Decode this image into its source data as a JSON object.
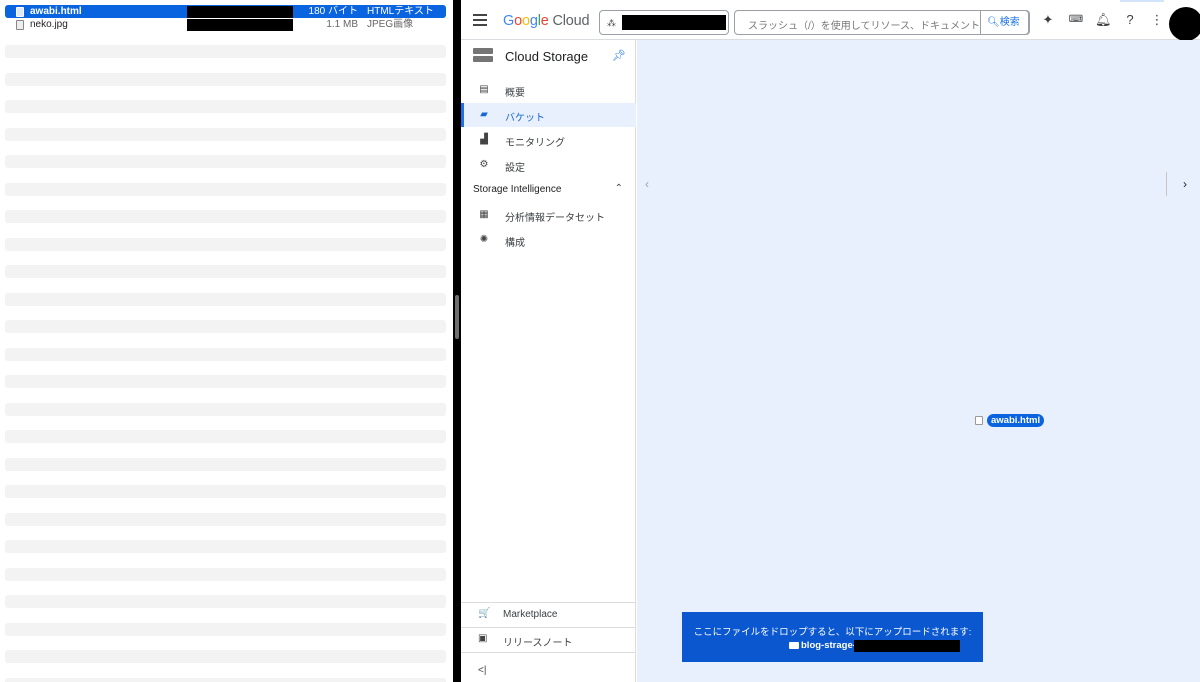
{
  "finder": {
    "files": [
      {
        "name": "awabi.html",
        "size": "180 バイト",
        "kind": "HTMLテキスト",
        "selected": true
      },
      {
        "name": "neko.jpg",
        "size": "1.1 MB",
        "kind": "JPEG画像",
        "selected": false
      }
    ]
  },
  "gcloud": {
    "logo": {
      "g": "G",
      "o1": "o",
      "o2": "o",
      "g2": "g",
      "l": "l",
      "e": "e",
      "cloud": " Cloud"
    },
    "search": {
      "placeholder": "スラッシュ（/）を使用してリソース、ドキュメント、プロダクトなどを検索",
      "button": "検索"
    },
    "icons": {
      "gemini": "sparkle-icon",
      "shell": "terminal-icon",
      "bell": "bell-icon",
      "help": "help-icon",
      "more": "more-vert-icon"
    },
    "sidebar": {
      "title": "Cloud Storage",
      "items": [
        {
          "label": "概要",
          "icon": "▤"
        },
        {
          "label": "バケット",
          "icon": "▰"
        },
        {
          "label": "モニタリング",
          "icon": "▟"
        },
        {
          "label": "設定",
          "icon": "⚙"
        }
      ],
      "section": "Storage Intelligence",
      "section_items": [
        {
          "label": "分析情報データセット",
          "icon": "▦"
        },
        {
          "label": "構成",
          "icon": "✺"
        }
      ],
      "bottom": [
        {
          "label": "Marketplace",
          "icon": "🛒"
        },
        {
          "label": "リリースノート",
          "icon": "▣"
        }
      ],
      "collapse": "<|"
    },
    "drop": {
      "dragging_file": "awabi.html",
      "message": "ここにファイルをドロップすると、以下にアップロードされます:",
      "bucket_prefix": "blog-strage-"
    },
    "colors": {
      "accent": "#1a73e8",
      "drop_panel": "#0b57d0",
      "overlay": "#e8f0fe",
      "finder_selection": "#0a64e0"
    }
  }
}
